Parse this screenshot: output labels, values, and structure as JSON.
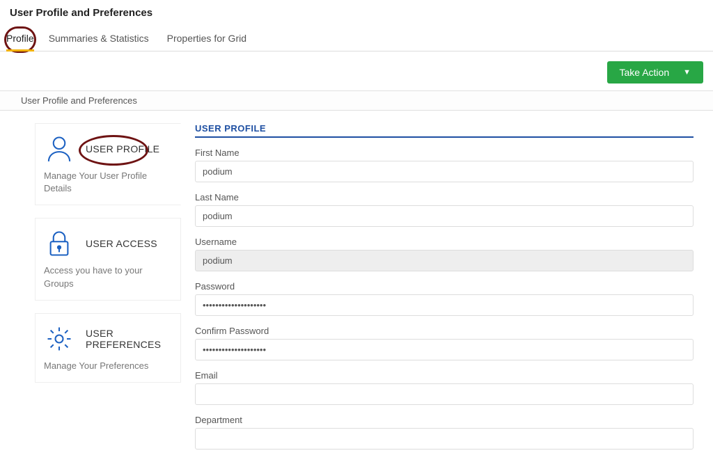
{
  "header": {
    "title": "User Profile and Preferences"
  },
  "tabs": {
    "items": [
      {
        "label": "Profile"
      },
      {
        "label": "Summaries & Statistics"
      },
      {
        "label": "Properties for Grid"
      }
    ]
  },
  "action": {
    "takeAction": "Take Action"
  },
  "breadcrumb": {
    "text": "User Profile and Preferences"
  },
  "sidebar": {
    "items": [
      {
        "title": "USER PROFILE",
        "desc": "Manage Your User Profile Details"
      },
      {
        "title": "USER ACCESS",
        "desc": "Access you have to your Groups"
      },
      {
        "title": "USER PREFERENCES",
        "desc": "Manage Your Preferences"
      }
    ]
  },
  "form": {
    "title": "USER PROFILE",
    "fields": {
      "firstName": {
        "label": "First Name",
        "value": "podium"
      },
      "lastName": {
        "label": "Last Name",
        "value": "podium"
      },
      "username": {
        "label": "Username",
        "value": "podium"
      },
      "password": {
        "label": "Password",
        "value": "••••••••••••••••••••"
      },
      "confirm": {
        "label": "Confirm Password",
        "value": "••••••••••••••••••••"
      },
      "email": {
        "label": "Email",
        "value": ""
      },
      "department": {
        "label": "Department",
        "value": ""
      }
    }
  }
}
